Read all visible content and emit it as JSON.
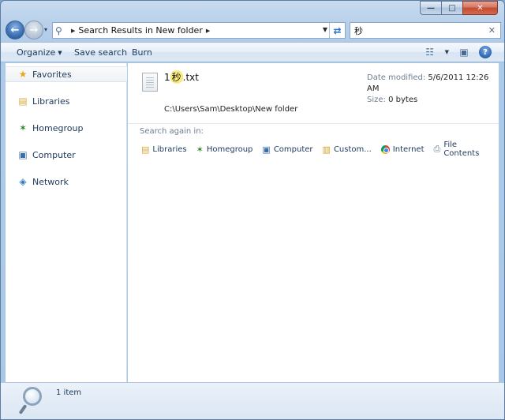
{
  "window": {
    "caption": {
      "minimize_glyph": "—",
      "maximize_glyph": "□",
      "close_glyph": "✕"
    }
  },
  "navigation": {
    "back_glyph": "←",
    "forward_glyph": "→",
    "history_glyph": "▾",
    "address": {
      "icon": "search-icon",
      "breadcrumb": "Search Results in New folder",
      "separator": "▶",
      "dropdown_glyph": "▼",
      "refresh_glyph": "⇄"
    },
    "search": {
      "value": "秒",
      "clear_glyph": "✕"
    }
  },
  "toolbar": {
    "organize": "Organize",
    "organize_arrow": "▼",
    "save_search": "Save search",
    "burn": "Burn",
    "views_glyph": "☷",
    "views_arrow": "▼",
    "preview_glyph": "▣",
    "help_glyph": "?"
  },
  "sidebar": {
    "items": [
      {
        "label": "Favorites",
        "icon": "star-icon",
        "glyph": "★",
        "selected": true
      },
      {
        "label": "Libraries",
        "icon": "libraries-icon",
        "glyph": "▤"
      },
      {
        "label": "Homegroup",
        "icon": "homegroup-icon",
        "glyph": "✶"
      },
      {
        "label": "Computer",
        "icon": "computer-icon",
        "glyph": "▣"
      },
      {
        "label": "Network",
        "icon": "network-icon",
        "glyph": "◈"
      }
    ]
  },
  "results": {
    "file": {
      "name_prefix": "1",
      "name_highlight": "秒",
      "name_suffix": ".txt",
      "path": "C:\\Users\\Sam\\Desktop\\New folder",
      "date_modified_label": "Date modified:",
      "date_modified_value": "5/6/2011 12:26 AM",
      "size_label": "Size:",
      "size_value": "0 bytes"
    },
    "search_again": {
      "label": "Search again in:",
      "items": [
        {
          "label": "Libraries",
          "icon": "libraries-icon",
          "glyph": "▤"
        },
        {
          "label": "Homegroup",
          "icon": "homegroup-icon",
          "glyph": "✶"
        },
        {
          "label": "Computer",
          "icon": "computer-icon",
          "glyph": "▣"
        },
        {
          "label": "Custom...",
          "icon": "custom-folder-icon",
          "glyph": "▥"
        },
        {
          "label": "Internet",
          "icon": "internet-icon",
          "glyph": ""
        },
        {
          "label": "File Contents",
          "icon": "file-contents-icon",
          "glyph": "⎙"
        }
      ]
    }
  },
  "status_bar": {
    "item_count": "1 item"
  },
  "colors": {
    "accent": "#1e395b",
    "highlight": "#fff17a",
    "close_button": "#c24b31"
  }
}
